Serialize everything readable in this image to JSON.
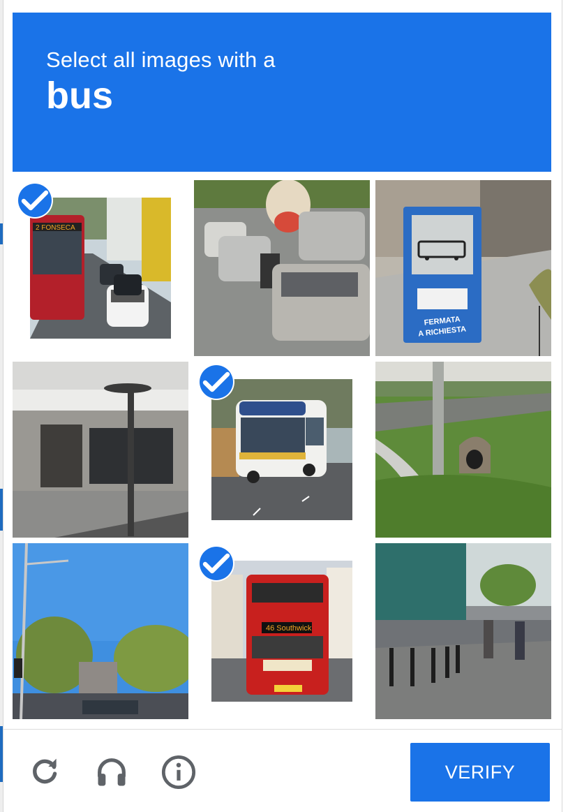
{
  "challenge": {
    "instruction": "Select all images with a",
    "target": "bus"
  },
  "tiles": [
    {
      "index": 1,
      "content": "red bus on road with cars",
      "selected": true
    },
    {
      "index": 2,
      "content": "traffic with cars and scooter",
      "selected": false
    },
    {
      "index": 3,
      "content": "bus stop sign",
      "selected": false
    },
    {
      "index": 4,
      "content": "building entrance with lamp post",
      "selected": false
    },
    {
      "index": 5,
      "content": "white and blue bus",
      "selected": true
    },
    {
      "index": 6,
      "content": "grass embankment with culvert",
      "selected": false
    },
    {
      "index": 7,
      "content": "street with trees and sky",
      "selected": false
    },
    {
      "index": 8,
      "content": "red double-decker bus",
      "selected": true
    },
    {
      "index": 9,
      "content": "street with bollards and pedestrians",
      "selected": false
    }
  ],
  "sign_text": {
    "line1": "FERMATA",
    "line2": "A RICHIESTA"
  },
  "bus_front_text": {
    "tile1": "2 FONSECA",
    "tile8": "46 Southwick"
  },
  "footer": {
    "reload_icon": "reload-icon",
    "audio_icon": "headphones-icon",
    "info_icon": "info-icon",
    "verify_label": "VERIFY"
  },
  "colors": {
    "accent": "#1a73e8",
    "check": "#1a73e8"
  }
}
